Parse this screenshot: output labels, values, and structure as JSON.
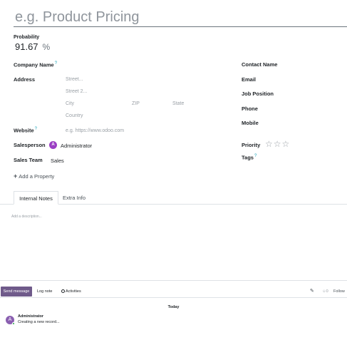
{
  "form": {
    "title_placeholder": "e.g. Product Pricing",
    "probability": {
      "label": "Probability",
      "value": "91.67",
      "unit": "%"
    },
    "left": {
      "company_name_label": "Company Name",
      "address_label": "Address",
      "street_placeholder": "Street...",
      "street2_placeholder": "Street 2...",
      "city_placeholder": "City",
      "zip_placeholder": "ZIP",
      "state_placeholder": "State",
      "country_placeholder": "Country",
      "website_label": "Website",
      "website_placeholder": "e.g. https://www.odoo.com",
      "salesperson_label": "Salesperson",
      "salesperson_initial": "A",
      "salesperson_value": "Administrator",
      "sales_team_label": "Sales Team",
      "sales_team_value": "Sales"
    },
    "right": {
      "contact_name_label": "Contact Name",
      "email_label": "Email",
      "job_position_label": "Job Position",
      "phone_label": "Phone",
      "mobile_label": "Mobile",
      "priority_label": "Priority",
      "priority_value": 0,
      "priority_max": 3,
      "tags_label": "Tags"
    },
    "help_marker": "?",
    "add_property_label": "Add a Property",
    "tabs": [
      {
        "label": "Internal Notes",
        "active": true
      },
      {
        "label": "Extra Info",
        "active": false
      }
    ],
    "description_placeholder": "Add a description..."
  },
  "chatter": {
    "send_message": "Send message",
    "log_note": "Log note",
    "activities": "Activities",
    "follower_count": "0",
    "follow": "Follow",
    "date_separator": "Today",
    "messages": [
      {
        "avatar_initial": "A",
        "author": "Administrator",
        "body": "Creating a new record..."
      }
    ]
  },
  "colors": {
    "primary": "#6f5a8a",
    "avatar": "#9b3fc4",
    "help": "#17a2b8"
  }
}
